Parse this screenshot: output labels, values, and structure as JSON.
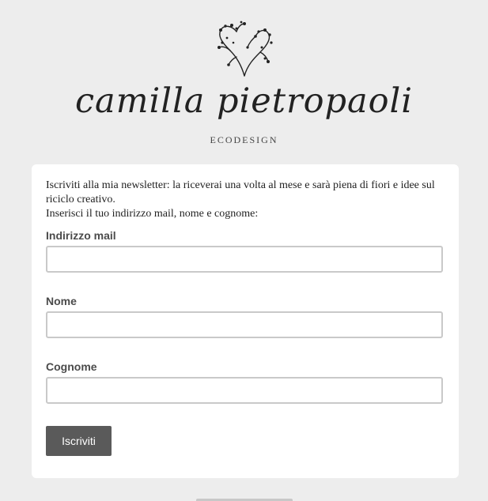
{
  "brand": {
    "name": "camilla pietropaoli",
    "subtitle": "ECODESIGN"
  },
  "form": {
    "intro_line1": "Iscriviti alla mia newsletter: la riceverai una volta al mese e sarà piena di fiori e idee sul riciclo creativo.",
    "intro_line2": "Inserisci il tuo indirizzo mail, nome e cognome:",
    "email_label": "Indirizzo mail",
    "email_value": "",
    "name_label": "Nome",
    "name_value": "",
    "surname_label": "Cognome",
    "surname_value": "",
    "submit_label": "Iscriviti"
  },
  "colors": {
    "background": "#ededed",
    "card": "#ffffff",
    "button": "#5a5a5a",
    "input_border": "#c9c9c9"
  }
}
